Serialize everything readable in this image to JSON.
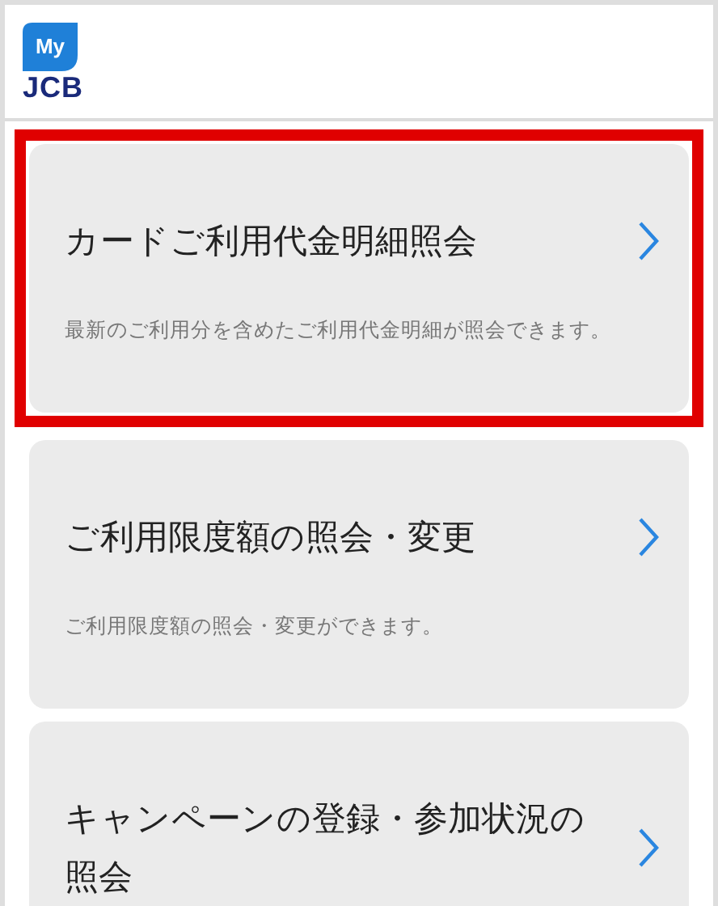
{
  "header": {
    "logo_badge": "My",
    "logo_text": "JCB"
  },
  "menu_items": [
    {
      "title": "カードご利用代金明細照会",
      "description": "最新のご利用分を含めたご利用代金明細が照会できます。",
      "highlighted": true
    },
    {
      "title": "ご利用限度額の照会・変更",
      "description": "ご利用限度額の照会・変更ができます。",
      "highlighted": false
    },
    {
      "title": "キャンペーンの登録・参加状況の照会",
      "highlighted": false
    }
  ]
}
